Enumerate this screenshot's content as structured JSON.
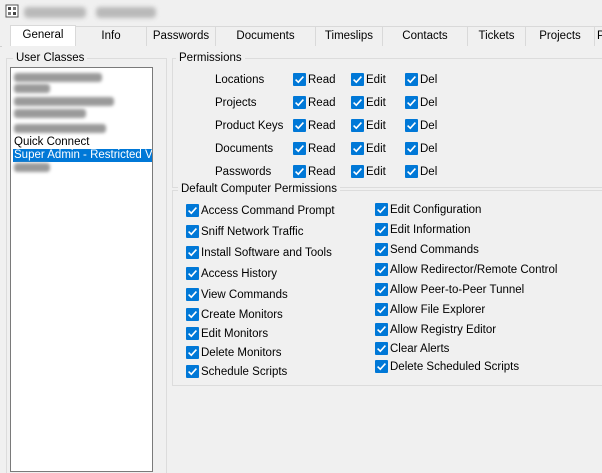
{
  "tabs": [
    "General",
    "Info",
    "Passwords",
    "Documents",
    "Timeslips",
    "Contacts",
    "Tickets",
    "Projects",
    "P"
  ],
  "user_classes": {
    "title": "User Classes",
    "items": [
      {
        "label": "",
        "blurred": true
      },
      {
        "label": "",
        "blurred": true
      },
      {
        "label": "",
        "blurred": true
      },
      {
        "label": "",
        "blurred": true
      },
      {
        "label": "",
        "blurred": true
      },
      {
        "label": "Quick Connect",
        "blurred": false
      },
      {
        "label": "Super Admin - Restricted Ver",
        "blurred": false,
        "selected": true
      },
      {
        "label": "",
        "blurred": true
      }
    ]
  },
  "permissions": {
    "title": "Permissions",
    "column_labels": [
      "Read",
      "Edit",
      "Del"
    ],
    "rows": [
      {
        "label": "Locations",
        "read": true,
        "edit": true,
        "del": true
      },
      {
        "label": "Projects",
        "read": true,
        "edit": true,
        "del": true
      },
      {
        "label": "Product Keys",
        "read": true,
        "edit": true,
        "del": true
      },
      {
        "label": "Documents",
        "read": true,
        "edit": true,
        "del": true
      },
      {
        "label": "Passwords",
        "read": true,
        "edit": true,
        "del": true
      }
    ]
  },
  "computer_permissions": {
    "title": "Default Computer Permissions",
    "left": [
      {
        "label": "Access Command Prompt",
        "checked": true
      },
      {
        "label": "Sniff Network Traffic",
        "checked": true
      },
      {
        "label": "Install Software and Tools",
        "checked": true
      },
      {
        "label": "Access History",
        "checked": true
      },
      {
        "label": "View Commands",
        "checked": true
      },
      {
        "label": "Create Monitors",
        "checked": true
      },
      {
        "label": "Edit Monitors",
        "checked": true
      },
      {
        "label": "Delete Monitors",
        "checked": true
      },
      {
        "label": "Schedule Scripts",
        "checked": true
      }
    ],
    "right": [
      {
        "label": "Edit Configuration",
        "checked": true
      },
      {
        "label": "Edit Information",
        "checked": true
      },
      {
        "label": "Send Commands",
        "checked": true
      },
      {
        "label": "Allow Redirector/Remote Control",
        "checked": true
      },
      {
        "label": "Allow Peer-to-Peer Tunnel",
        "checked": true
      },
      {
        "label": "Allow File Explorer",
        "checked": true
      },
      {
        "label": "Allow Registry Editor",
        "checked": true
      },
      {
        "label": "Clear Alerts",
        "checked": true
      },
      {
        "label": "Delete Scheduled Scripts",
        "checked": true
      }
    ]
  },
  "colors": {
    "accent": "#0078d7",
    "background": "#f0f0f0"
  }
}
